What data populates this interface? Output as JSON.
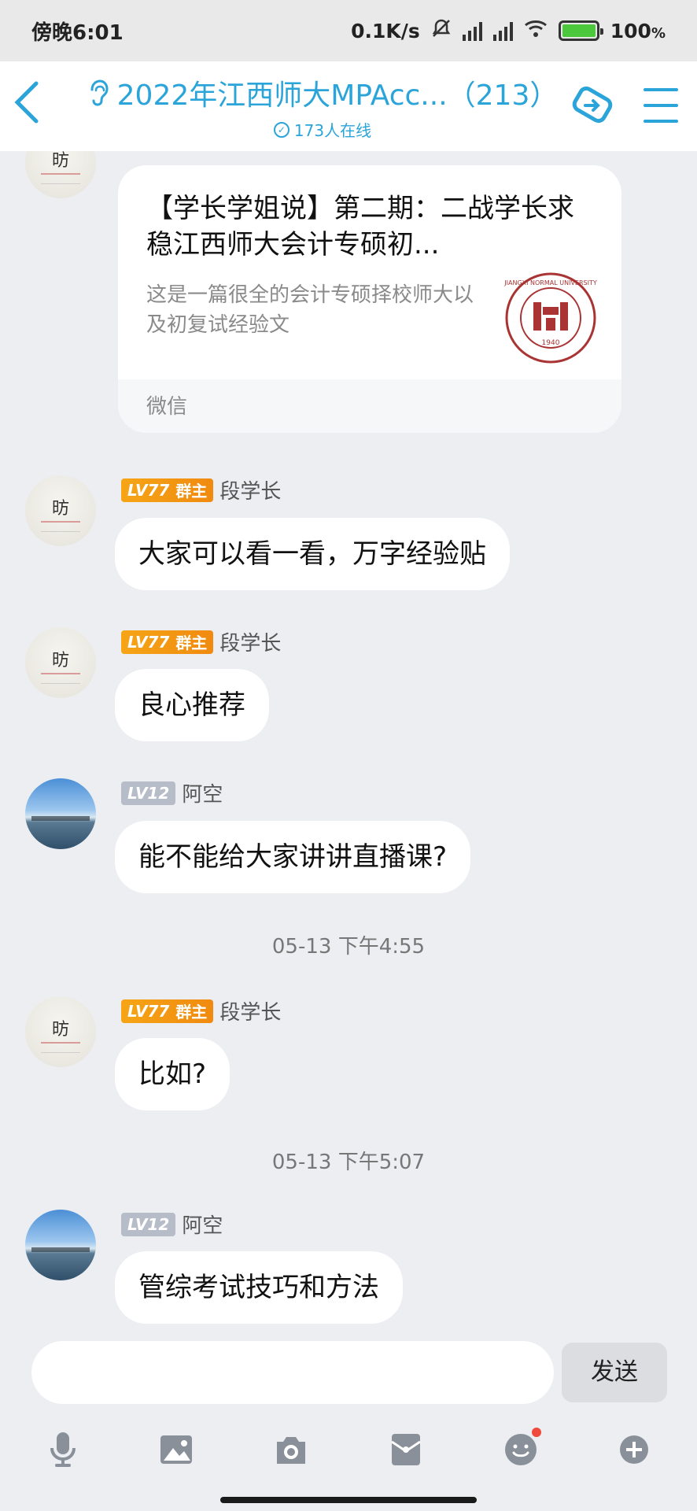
{
  "status_bar": {
    "time": "傍晚6:01",
    "net_speed": "0.1K/s",
    "battery": "100",
    "battery_unit": "%"
  },
  "header": {
    "title": "2022年江西师大MPAcc...（213）",
    "online": "173人在线",
    "accent_color": "#2aa4d9"
  },
  "card": {
    "title": "【学长学姐说】第二期：二战学长求稳江西师大会计专硕初...",
    "desc": "这是一篇很全的会计专硕择校师大以及初复试经验文",
    "source": "微信",
    "logo_text": "JIANGXI NORMAL UNIVERSITY",
    "logo_year": "1940"
  },
  "messages": [
    {
      "level": "LV77",
      "role": "群主",
      "sender": "段学长",
      "text": "大家可以看一看，万字经验贴"
    },
    {
      "level": "LV77",
      "role": "群主",
      "sender": "段学长",
      "text": "良心推荐"
    },
    {
      "level": "LV12",
      "role": "",
      "sender": "阿空",
      "text": "能不能给大家讲讲直播课?"
    },
    {
      "level": "LV77",
      "role": "群主",
      "sender": "段学长",
      "text": "比如?"
    },
    {
      "level": "LV12",
      "role": "",
      "sender": "阿空",
      "text": "管综考试技巧和方法"
    }
  ],
  "time_separators": [
    "05-13 下午4:55",
    "05-13 下午5:07"
  ],
  "input": {
    "placeholder": "",
    "send_label": "发送"
  },
  "toolbar_icons": [
    "microphone-icon",
    "image-icon",
    "camera-icon",
    "red-packet-icon",
    "emoji-icon",
    "plus-icon"
  ],
  "avatar_glyph": "昉"
}
